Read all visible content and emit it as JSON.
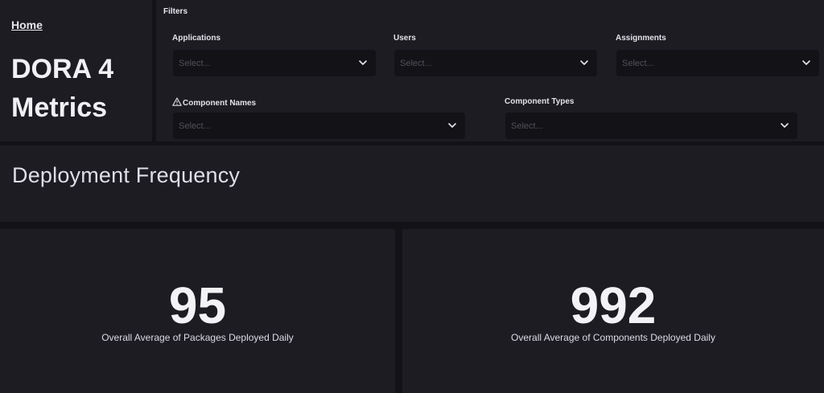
{
  "nav": {
    "home_label": "Home"
  },
  "dashboard": {
    "title": "DORA 4 Metrics"
  },
  "filters": {
    "heading": "Filters",
    "applications": {
      "label": "Applications",
      "placeholder": "Select..."
    },
    "users": {
      "label": "Users",
      "placeholder": "Select..."
    },
    "assignments": {
      "label": "Assignments",
      "placeholder": "Select..."
    },
    "component_names": {
      "label": "Component Names",
      "placeholder": "Select...",
      "icon": "warning-icon"
    },
    "component_types": {
      "label": "Component Types",
      "placeholder": "Select..."
    }
  },
  "section": {
    "title": "Deployment Frequency"
  },
  "kpis": {
    "packages": {
      "value": "95",
      "label": "Overall Average of Packages Deployed Daily"
    },
    "components": {
      "value": "992",
      "label": "Overall Average of Components Deployed Daily"
    }
  },
  "colors": {
    "page_background": "#121217",
    "panel_background": "#1d1c23",
    "input_background": "#121217",
    "text_primary": "#f1f1f5",
    "placeholder": "#505058"
  }
}
